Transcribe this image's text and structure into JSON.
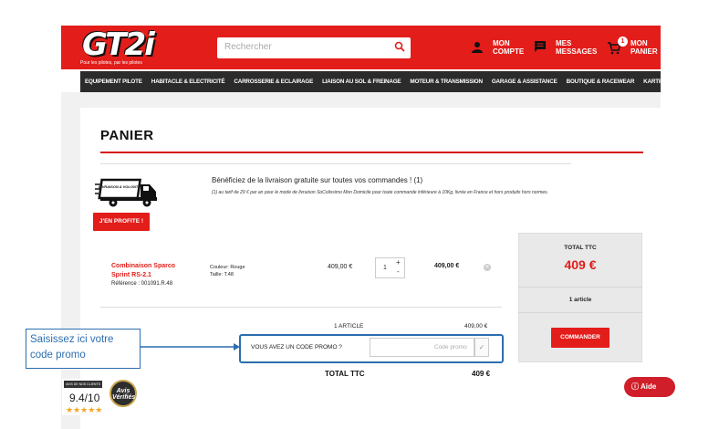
{
  "header": {
    "logo": "GT2i",
    "tagline": "Pour les pilotes, par les pilotes",
    "search_placeholder": "Rechercher",
    "account": [
      "MON",
      "COMPTE"
    ],
    "messages": [
      "MES",
      "MESSAGES"
    ],
    "cart": [
      "MON",
      "PANIER"
    ],
    "cart_count": "1"
  },
  "nav": [
    "EQUIPEMENT PILOTE",
    "HABITACLE & ELECTRICITÉ",
    "CARROSSERIE & ECLAIRAGE",
    "LIAISON AU SOL & FREINAGE",
    "MOTEUR & TRANSMISSION",
    "GARAGE & ASSISTANCE",
    "BOUTIQUE & RACEWEAR",
    "KARTING"
  ],
  "cart": {
    "title": "PANIER",
    "promo_banner": {
      "truck_label": "LIVRAISON A VOLONTÉ",
      "title": "Bénéficiez de la livraison gratuite sur toutes vos commandes ! (1)",
      "note": "(1) au tarif de 29 € par an pour le mode de livraison SoColissimo Mon Domicile pour toute commande inférieure à 10Kg, livrée en France et hors produits hors normes.",
      "button": "J'EN PROFITE !"
    },
    "product": {
      "name": "Combinaison Sparco Sprint RS-2.1",
      "reference": "Référence : 001091.R.48",
      "color": "Couleur: Rouge",
      "size": "Taille: T.48",
      "unit_price": "409,00 €",
      "quantity": "1",
      "total": "409,00 €"
    },
    "articles_label": "1 ARTICLE",
    "articles_value": "409,00 €",
    "promo_label": "VOUS AVEZ UN CODE PROMO ?",
    "promo_placeholder": "Code promo",
    "total_label": "TOTAL TTC",
    "total_value": "409 €"
  },
  "summary": {
    "label": "TOTAL TTC",
    "total": "409 €",
    "count": "1 article",
    "button": "COMMANDER"
  },
  "callout": "Saisissez ici votre code promo",
  "reviews": {
    "header": "AVIS DE NOS CLIENTS",
    "score": "9.4/10",
    "stars": "★★★★★",
    "seal": "Avis Vérifiés"
  },
  "help": "Aide",
  "colors": {
    "brand_red": "#e31d1a",
    "callout_blue": "#2c6eb0",
    "nav_dark": "#2b2b2b"
  }
}
